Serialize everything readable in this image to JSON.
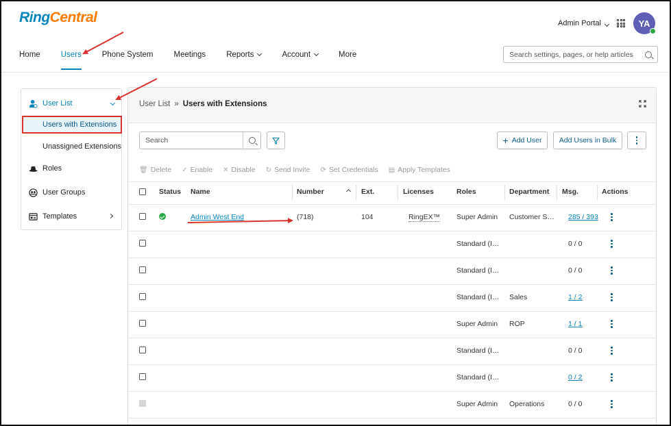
{
  "brand": {
    "ring": "Ring",
    "central": "Central"
  },
  "header": {
    "admin_portal": "Admin Portal",
    "avatar_initials": "YA",
    "search_placeholder": "Search settings, pages, or help articles"
  },
  "topnav": [
    {
      "label": "Home"
    },
    {
      "label": "Users"
    },
    {
      "label": "Phone System"
    },
    {
      "label": "Meetings"
    },
    {
      "label": "Reports"
    },
    {
      "label": "Account"
    },
    {
      "label": "More"
    }
  ],
  "sidebar": {
    "user_list": "User List",
    "users_with_extensions": "Users with Extensions",
    "unassigned_extensions": "Unassigned Extensions",
    "roles": "Roles",
    "user_groups": "User Groups",
    "templates": "Templates"
  },
  "panel": {
    "breadcrumb_parent": "User List",
    "breadcrumb_sep": "»",
    "breadcrumb_current": "Users with Extensions",
    "search_placeholder": "Search",
    "add_user": "Add User",
    "add_users_bulk": "Add Users in Bulk"
  },
  "actions": {
    "delete": "Delete",
    "enable": "Enable",
    "disable": "Disable",
    "send_invite": "Send Invite",
    "set_credentials": "Set Credentials",
    "apply_templates": "Apply Templates"
  },
  "table": {
    "headers": {
      "status": "Status",
      "name": "Name",
      "number": "Number",
      "ext": "Ext.",
      "licenses": "Licenses",
      "roles": "Roles",
      "department": "Department",
      "msg": "Msg.",
      "actions": "Actions"
    },
    "rows": [
      {
        "name": "Admin West End",
        "number": "(718)",
        "ext": "104",
        "licenses": "RingEX™",
        "role": "Super Admin",
        "department": "Customer S…",
        "msg": "285 / 393"
      },
      {
        "name": "",
        "number": "",
        "ext": "",
        "licenses": "",
        "role": "Standard (I…",
        "department": "",
        "msg": "0 / 0"
      },
      {
        "name": "",
        "number": "",
        "ext": "",
        "licenses": "",
        "role": "Standard (I…",
        "department": "",
        "msg": "0 / 0"
      },
      {
        "name": "",
        "number": "",
        "ext": "",
        "licenses": "",
        "role": "Standard (I…",
        "department": "Sales",
        "msg": "1 / 2"
      },
      {
        "name": "",
        "number": "",
        "ext": "",
        "licenses": "",
        "role": "Super Admin",
        "department": "ROP",
        "msg": "1 / 1"
      },
      {
        "name": "",
        "number": "",
        "ext": "",
        "licenses": "",
        "role": "Standard (I…",
        "department": "",
        "msg": "0 / 0"
      },
      {
        "name": "",
        "number": "",
        "ext": "",
        "licenses": "",
        "role": "Standard (I…",
        "department": "",
        "msg": "0 / 2"
      },
      {
        "name": "",
        "number": "",
        "ext": "",
        "licenses": "",
        "role": "Super Admin",
        "department": "Operations",
        "msg": "0 / 0"
      }
    ]
  },
  "colors": {
    "accent": "#0684bc",
    "brand_orange": "#ff7a00",
    "annotation_red": "#d9322f",
    "status_green": "#2ca847"
  }
}
